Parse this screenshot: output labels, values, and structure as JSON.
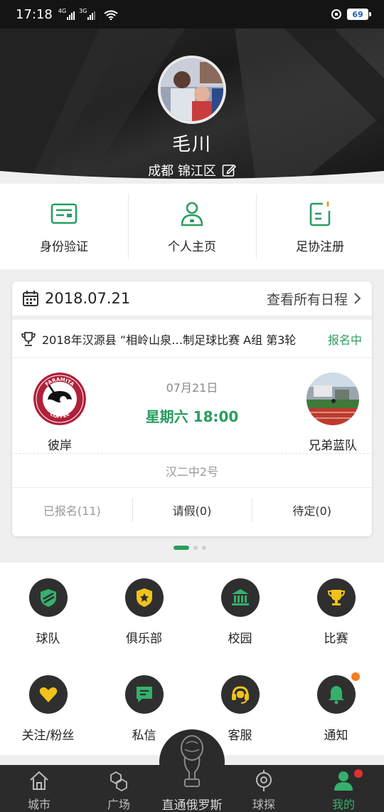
{
  "status_bar": {
    "time": "17:18",
    "network1": "4G",
    "network2": "3G",
    "battery": "69"
  },
  "profile": {
    "name": "毛川",
    "location": "成都 锦江区"
  },
  "quick_actions": [
    {
      "label": "身份验证",
      "icon": "id-card-icon"
    },
    {
      "label": "个人主页",
      "icon": "person-icon"
    },
    {
      "label": "足协注册",
      "icon": "registration-icon"
    }
  ],
  "schedule": {
    "date": "2018.07.21",
    "view_all": "查看所有日程",
    "match_title": "2018年汉源县 ”相岭山泉…制足球比赛 A组 第3轮",
    "match_status": "报名中",
    "home_team": "彼岸",
    "home_logo_text_top": "FARAMITA",
    "home_logo_text_bottom": "COFFEE",
    "away_team": "兄弟蓝队",
    "match_date": "07月21日",
    "match_time": "星期六 18:00",
    "venue": "汉二中2号",
    "signed_up": "已报名(11)",
    "leave": "请假(0)",
    "pending": "待定(0)"
  },
  "features": [
    {
      "label": "球队",
      "icon": "shield-icon"
    },
    {
      "label": "俱乐部",
      "icon": "club-badge-icon"
    },
    {
      "label": "校园",
      "icon": "school-building-icon"
    },
    {
      "label": "比赛",
      "icon": "trophy-icon"
    },
    {
      "label": "关注/粉丝",
      "icon": "heart-icon"
    },
    {
      "label": "私信",
      "icon": "message-icon"
    },
    {
      "label": "客服",
      "icon": "headset-icon"
    },
    {
      "label": "通知",
      "icon": "bell-icon"
    }
  ],
  "colors": {
    "accent_green": "#2a9d60",
    "notify_orange": "#f57c1f",
    "badge_red": "#e53030"
  },
  "bottom_nav": {
    "city": "城市",
    "plaza": "广场",
    "center": "直通俄罗斯",
    "explore": "球探",
    "mine": "我的"
  }
}
